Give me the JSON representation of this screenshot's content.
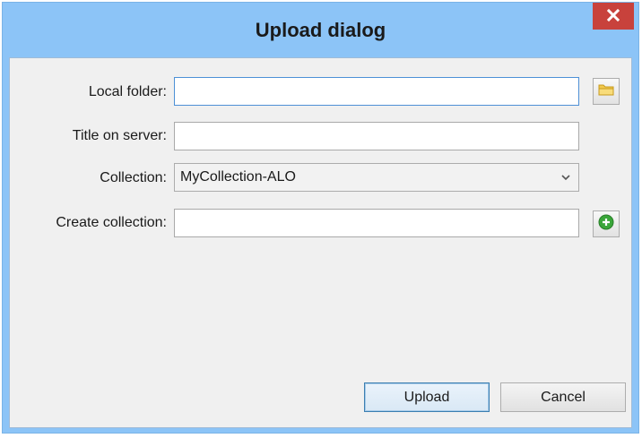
{
  "window": {
    "title": "Upload dialog",
    "close_label": "✕"
  },
  "form": {
    "local_folder_label": "Local folder:",
    "local_folder_value": "",
    "title_on_server_label": "Title on server:",
    "title_on_server_value": "",
    "collection_label": "Collection:",
    "collection_selected": "MyCollection-ALO",
    "create_collection_label": "Create collection:",
    "create_collection_value": ""
  },
  "buttons": {
    "upload_label": "Upload",
    "cancel_label": "Cancel"
  },
  "icons": {
    "browse": "folder-icon",
    "add": "plus-circle-icon",
    "dropdown": "chevron-down-icon",
    "close": "close-icon"
  },
  "colors": {
    "titlebar": "#8cc4f7",
    "close_button": "#c8423c",
    "client_background": "#f0f0f0",
    "focus_border": "#4d90d6",
    "add_icon": "#3aa63a",
    "folder_icon": "#f2c94c"
  }
}
